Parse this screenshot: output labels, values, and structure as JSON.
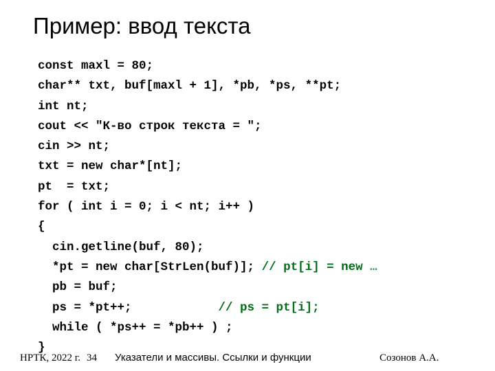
{
  "slide": {
    "title": "Пример: ввод текста",
    "background_color": "#ffffff",
    "text_color": "#000000",
    "comment_color": "#006E16"
  },
  "code": {
    "language": "cpp",
    "lines": [
      {
        "text": "const maxl = 80;",
        "comment": "",
        "ellipsis": ""
      },
      {
        "text": "char** txt, buf[maxl + 1], *pb, *ps, **pt;",
        "comment": "",
        "ellipsis": ""
      },
      {
        "text": "int nt;",
        "comment": "",
        "ellipsis": ""
      },
      {
        "text": "cout << \"К-во строк текста = \";",
        "comment": "",
        "ellipsis": ""
      },
      {
        "text": "cin >> nt;",
        "comment": "",
        "ellipsis": ""
      },
      {
        "text": "txt = new char*[nt];",
        "comment": "",
        "ellipsis": ""
      },
      {
        "text": "pt  = txt;",
        "comment": "",
        "ellipsis": ""
      },
      {
        "text": "for ( int i = 0; i < nt; i++ )",
        "comment": "",
        "ellipsis": ""
      },
      {
        "text": "{",
        "comment": "",
        "ellipsis": ""
      },
      {
        "text": "  cin.getline(buf, 80);",
        "comment": "",
        "ellipsis": ""
      },
      {
        "text": "  *pt = new char[StrLen(buf)]; ",
        "comment": "// pt[i] = new ",
        "ellipsis": "…"
      },
      {
        "text": "  pb = buf;",
        "comment": "",
        "ellipsis": ""
      },
      {
        "text": "  ps = *pt++;            ",
        "comment": "// ps = pt[i];",
        "ellipsis": ""
      },
      {
        "text": "  while ( *ps++ = *pb++ ) ;",
        "comment": "",
        "ellipsis": ""
      },
      {
        "text": "}",
        "comment": "",
        "ellipsis": ""
      }
    ]
  },
  "footer": {
    "organization": "НРТК, 2022 г.",
    "slide_number": "34",
    "topic": "Указатели и массивы. Ссылки и функции",
    "author": "Созонов А.А."
  }
}
